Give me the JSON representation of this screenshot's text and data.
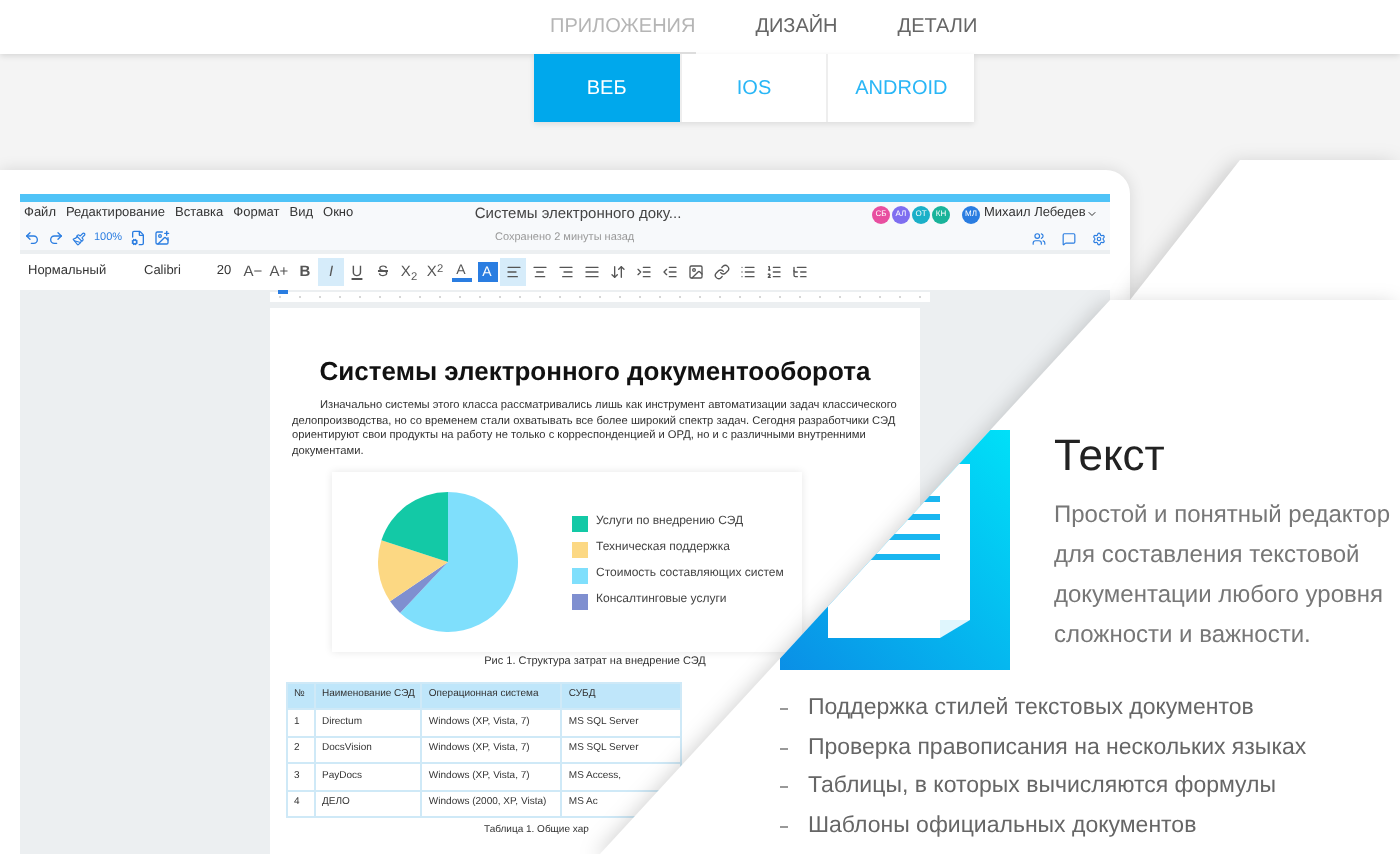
{
  "nav": {
    "tabs": [
      {
        "label": "ПРИЛОЖЕНИЯ",
        "selected": true
      },
      {
        "label": "ДИЗАЙН",
        "selected": false
      },
      {
        "label": "ДЕТАЛИ",
        "selected": false
      }
    ]
  },
  "platform_tabs": [
    {
      "label": "ВЕБ",
      "selected": true
    },
    {
      "label": "IOS",
      "selected": false
    },
    {
      "label": "ANDROID",
      "selected": false
    }
  ],
  "editor": {
    "menu": [
      "Файл",
      "Редактирование",
      "Вставка",
      "Формат",
      "Вид",
      "Окно"
    ],
    "document_title": "Системы электронного доку...",
    "save_status": "Сохранено 2 минуты назад",
    "zoom": "100%",
    "collaborators": [
      {
        "initials": "СБ",
        "color": "#e84fa0"
      },
      {
        "initials": "АЛ",
        "color": "#7e6ef0"
      },
      {
        "initials": "ОТ",
        "color": "#1bb0c8"
      },
      {
        "initials": "КН",
        "color": "#19b39a"
      }
    ],
    "user": {
      "initials": "МЛ",
      "name": "Михаил Лебедев"
    },
    "toolbar": {
      "style": "Нормальный",
      "font": "Calibri",
      "size": "20",
      "size_buttons": [
        "A−",
        "A+"
      ],
      "format_buttons": [
        {
          "kind": "bold",
          "label": "B",
          "selected": false
        },
        {
          "kind": "italic",
          "label": "I",
          "selected": true
        },
        {
          "kind": "underline",
          "label": "U",
          "selected": false
        },
        {
          "kind": "strike",
          "label": "S",
          "selected": false
        },
        {
          "kind": "plain",
          "label": "X$_{2}$",
          "selected": false
        },
        {
          "kind": "plain",
          "label": "X$^{2}$",
          "selected": false
        }
      ],
      "color_buttons": [
        {
          "kind": "font-color",
          "label": "A"
        },
        {
          "kind": "highlight",
          "label": "A"
        }
      ],
      "align_buttons": [
        {
          "selected": true
        },
        {
          "selected": false
        },
        {
          "selected": false
        },
        {
          "selected": false
        }
      ]
    }
  },
  "document": {
    "title": "Системы электронного документооборота",
    "paragraph": "Изначально системы этого класса рассматривались лишь как инструмент автоматизации задач классического делопроизводства, но со временем стали охватывать все более широкий спектр задач. Сегодня разработчики СЭД ориентируют свои продукты на работу не только с корреспонденцией и ОРД, но и с различными внутренними документами.",
    "legend": [
      {
        "label": "Услуги по внедрению СЭД",
        "color": "#13c9a6"
      },
      {
        "label": "Техническая поддержка",
        "color": "#fcd883"
      },
      {
        "label": "Стоимость составляющих систем",
        "color": "#7fdffc"
      },
      {
        "label": "Консалтинговые услуги",
        "color": "#7f8fd0"
      }
    ],
    "figure_caption": "Рис 1. Структура затрат на внедрение СЭД",
    "table": {
      "columns": [
        "№",
        "Наименование СЭД",
        "Операционная система",
        "СУБД"
      ],
      "rows": [
        [
          "1",
          "Directum",
          "Windows (XP, Vista, 7)",
          "MS SQL Server"
        ],
        [
          "2",
          "DocsVision",
          "Windows (XP, Vista, 7)",
          "MS SQL Server"
        ],
        [
          "3",
          "PayDocs",
          "Windows (XP, Vista, 7)",
          "MS Access,"
        ],
        [
          "4",
          "ДЕЛО",
          "Windows (2000, XP, Vista)",
          "MS Ac"
        ]
      ]
    },
    "table_caption": "Таблица 1. Общие хар"
  },
  "feature": {
    "title": "Текст",
    "description": "Простой и понятный редактор для составления текстовой документации любого уровня сложности и важности.",
    "points": [
      "Поддержка стилей текстовых документов",
      "Проверка правописания на нескольких языках",
      "Таблицы, в которых вычисляются формулы",
      "Шаблоны официальных документов"
    ]
  }
}
